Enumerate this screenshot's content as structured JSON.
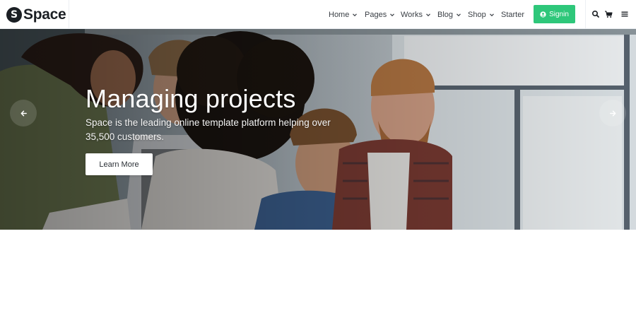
{
  "brand": {
    "mark": "S",
    "name": "Space"
  },
  "nav": {
    "items": [
      {
        "label": "Home",
        "dropdown": true
      },
      {
        "label": "Pages",
        "dropdown": true
      },
      {
        "label": "Works",
        "dropdown": true
      },
      {
        "label": "Blog",
        "dropdown": true
      },
      {
        "label": "Shop",
        "dropdown": true
      },
      {
        "label": "Starter",
        "dropdown": false
      }
    ],
    "signin_label": "Signin",
    "signin_icon": "user-circle-icon",
    "accent_color": "#2ec77a",
    "utility_icons": [
      "search-icon",
      "cart-icon",
      "menu-icon"
    ]
  },
  "hero": {
    "title": "Managing projects",
    "subtitle": "Space is the leading online template platform helping over 35,500 customers.",
    "button_label": "Learn More",
    "prev_icon": "arrow-left-icon",
    "next_icon": "arrow-right-icon"
  }
}
